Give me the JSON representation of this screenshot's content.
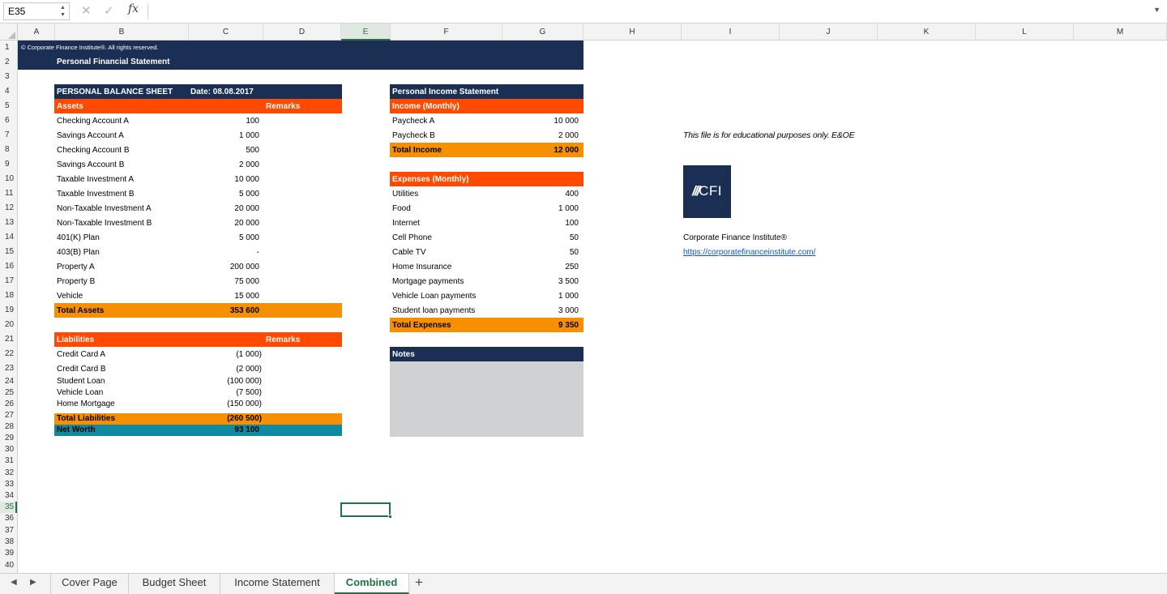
{
  "formula_bar": {
    "name_box": "E35",
    "cancel_icon": "✕",
    "enter_icon": "✓",
    "fx": "fx",
    "formula": ""
  },
  "columns": [
    "A",
    "B",
    "C",
    "D",
    "E",
    "F",
    "G",
    "H",
    "I",
    "J",
    "K",
    "L",
    "M"
  ],
  "rows": [
    "1",
    "2",
    "3",
    "4",
    "5",
    "6",
    "7",
    "8",
    "9",
    "10",
    "11",
    "12",
    "13",
    "14",
    "15",
    "16",
    "17",
    "18",
    "19",
    "20",
    "21",
    "22",
    "23",
    "24",
    "25",
    "26",
    "27",
    "28",
    "29",
    "30",
    "31",
    "32",
    "33",
    "34",
    "35",
    "36",
    "37",
    "38",
    "39",
    "40"
  ],
  "header": {
    "copyright": "© Corporate Finance Institute®. All rights reserved.",
    "title": "Personal Financial Statement"
  },
  "balance_sheet": {
    "title": "PERSONAL BALANCE SHEET",
    "date": "Date: 08.08.2017",
    "assets_label": "Assets",
    "remarks_label": "Remarks",
    "assets": [
      {
        "name": "Checking Account A",
        "value": "100"
      },
      {
        "name": "Savings Account A",
        "value": "1 000"
      },
      {
        "name": "Checking Account B",
        "value": "500"
      },
      {
        "name": "Savings Account B",
        "value": "2 000"
      },
      {
        "name": "Taxable Investment A",
        "value": "10 000"
      },
      {
        "name": "Taxable Investment B",
        "value": "5 000"
      },
      {
        "name": "Non-Taxable Investment A",
        "value": "20 000"
      },
      {
        "name": "Non-Taxable Investment B",
        "value": "20 000"
      },
      {
        "name": "401(K) Plan",
        "value": "5 000"
      },
      {
        "name": "403(B) Plan",
        "value": "-"
      },
      {
        "name": "Property A",
        "value": "200 000"
      },
      {
        "name": "Property B",
        "value": "75 000"
      },
      {
        "name": "Vehicle",
        "value": "15 000"
      }
    ],
    "total_assets_label": "Total Assets",
    "total_assets": "353 600",
    "liabilities_label": "Liabilities",
    "liabilities_remarks": "Remarks",
    "liabilities": [
      {
        "name": "Credit Card A",
        "value": "(1 000)"
      },
      {
        "name": "Credit Card B",
        "value": "(2 000)"
      },
      {
        "name": "Student Loan",
        "value": "(100 000)"
      },
      {
        "name": "Vehicle Loan",
        "value": "(7 500)"
      },
      {
        "name": "Home Mortgage",
        "value": "(150 000)"
      }
    ],
    "total_liabilities_label": "Total Liabilities",
    "total_liabilities": "(260 500)",
    "net_worth_label": "Net Worth",
    "net_worth": "93 100"
  },
  "income_statement": {
    "title": "Personal Income Statement",
    "income_label": "Income (Monthly)",
    "income": [
      {
        "name": "Paycheck A",
        "value": "10 000"
      },
      {
        "name": "Paycheck B",
        "value": "2 000"
      }
    ],
    "total_income_label": "Total Income",
    "total_income": "12 000",
    "expenses_label": "Expenses (Monthly)",
    "expenses": [
      {
        "name": "Utilities",
        "value": "400"
      },
      {
        "name": "Food",
        "value": "1 000"
      },
      {
        "name": "Internet",
        "value": "100"
      },
      {
        "name": "Cell Phone",
        "value": "50"
      },
      {
        "name": "Cable TV",
        "value": "50"
      },
      {
        "name": "Home Insurance",
        "value": "250"
      },
      {
        "name": "Mortgage payments",
        "value": "3 500"
      },
      {
        "name": "Vehicle Loan payments",
        "value": "1 000"
      },
      {
        "name": "Student loan payments",
        "value": "3 000"
      }
    ],
    "total_expenses_label": "Total Expenses",
    "total_expenses": "9 350",
    "notes_label": "Notes"
  },
  "side_info": {
    "disclaimer": "This file is for educational purposes only. E&OE",
    "logo_text": "CFI",
    "company": "Corporate Finance Institute®",
    "url": "https://corporatefinanceinstitute.com/"
  },
  "sheet_tabs": {
    "tabs": [
      "Cover Page",
      "Budget Sheet",
      "Income Statement",
      "Combined"
    ],
    "active": "Combined",
    "add": "+"
  },
  "colors": {
    "navy": "#1b2f55",
    "red_orange": "#ff4a00",
    "orange": "#f79000",
    "teal": "#0f8aa0",
    "notes_grey": "#d0d1d3",
    "excel_green": "#217346"
  }
}
